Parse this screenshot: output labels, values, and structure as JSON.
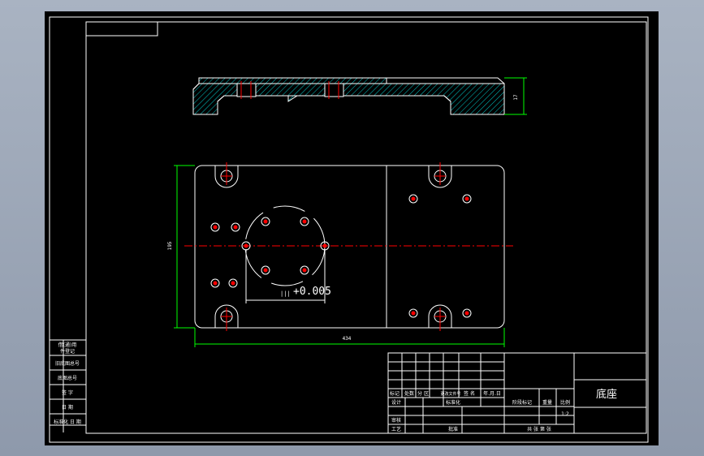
{
  "drawing": {
    "part_name": "底座",
    "scale": "1:2",
    "tolerance_note": "+0.005",
    "tolerance_prefix": "|||",
    "dim_height": "17",
    "dim_width": "434",
    "dim_side": "195"
  },
  "title_block": {
    "row_headers": [
      "标记",
      "处数",
      "分 区",
      "更改文件号",
      "签 名",
      "年.月.日"
    ],
    "design_label": "设计",
    "std_label": "标准化",
    "audit_label": "审核",
    "process_label": "工艺",
    "approve_label": "批准",
    "stage_label": "阶段标记",
    "weight_label": "重量",
    "scale_label": "比例",
    "sheets_label": "共  张  第  张"
  },
  "side_strip": [
    "借(通)用",
    "件登记",
    "旧底图总号",
    "底图总号",
    "签 字",
    "日 期",
    "标准化 日 期"
  ],
  "colors": {
    "background": "#000000",
    "lines": "#ffffff",
    "centerline": "#ff0000",
    "dimension": "#00ff00",
    "hatch": "#00c8c8"
  }
}
